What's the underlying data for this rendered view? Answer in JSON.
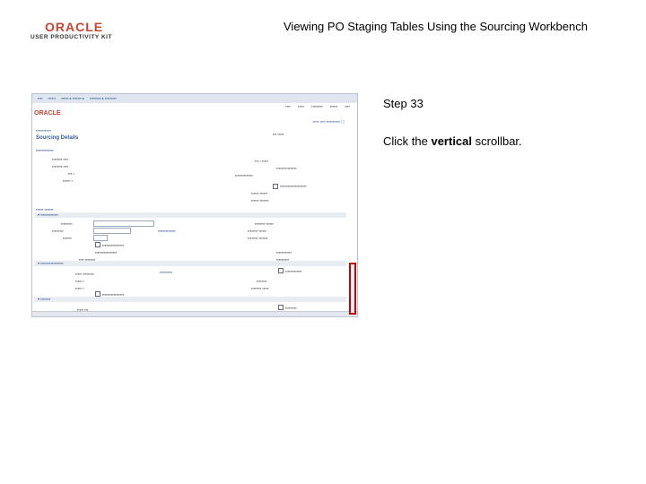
{
  "logo": {
    "brand": "ORACLE",
    "subtitle": "USER PRODUCTIVITY KIT"
  },
  "slide": {
    "title": "Viewing PO Staging Tables Using the Sourcing Workbench",
    "step": "Step 33",
    "instruction_prefix": "Click the ",
    "instruction_bold": "vertical",
    "instruction_suffix": " scrollbar."
  },
  "screenshot": {
    "page_title": "Sourcing Details",
    "mini_logo": "ORACLE"
  },
  "colors": {
    "highlight": "#cc0000",
    "oracle_red": "#c74634"
  }
}
